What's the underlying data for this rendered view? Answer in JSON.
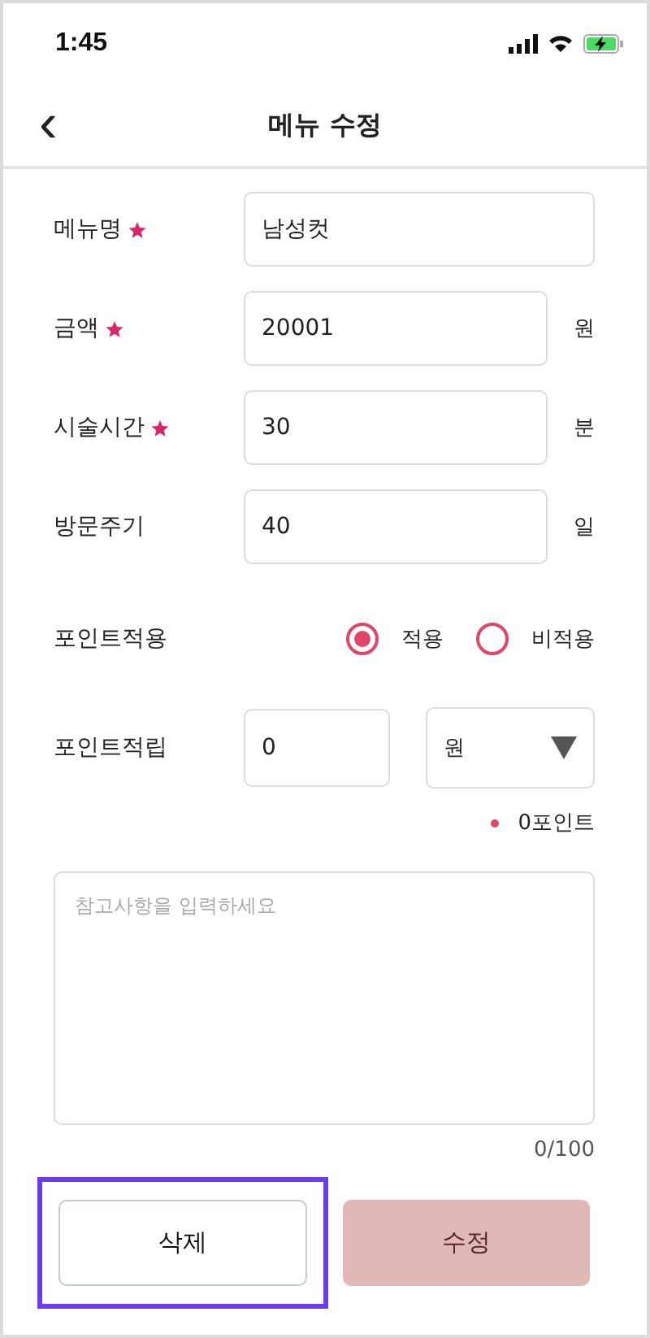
{
  "status_bar": {
    "time": "1:45"
  },
  "header": {
    "back": "‹",
    "title": "메뉴 수정"
  },
  "fields": [
    {
      "label": "메뉴명",
      "required": true,
      "value": "남성컷"
    },
    {
      "label": "금액",
      "required": true,
      "value": "20001",
      "unit": "원"
    },
    {
      "label": "시술시간",
      "required": true,
      "value": "30",
      "unit": "분"
    },
    {
      "label": "방문주기",
      "required": false,
      "value": "40",
      "unit": "일"
    }
  ],
  "point_apply": {
    "label": "포인트적용",
    "options": [
      {
        "label": "적용",
        "selected": true
      },
      {
        "label": "비적용",
        "selected": false
      }
    ]
  },
  "point_accrual": {
    "label": "포인트적립",
    "value": "0",
    "select": "원",
    "note": "0포인트"
  },
  "memo": {
    "placeholder": "참고사항을 입력하세요",
    "counter": "0/100"
  },
  "buttons": [
    {
      "label": "삭제",
      "kind": "outline",
      "disabled": false,
      "focused": true
    },
    {
      "label": "수정",
      "kind": "primary",
      "disabled": true,
      "focused": false
    }
  ]
}
